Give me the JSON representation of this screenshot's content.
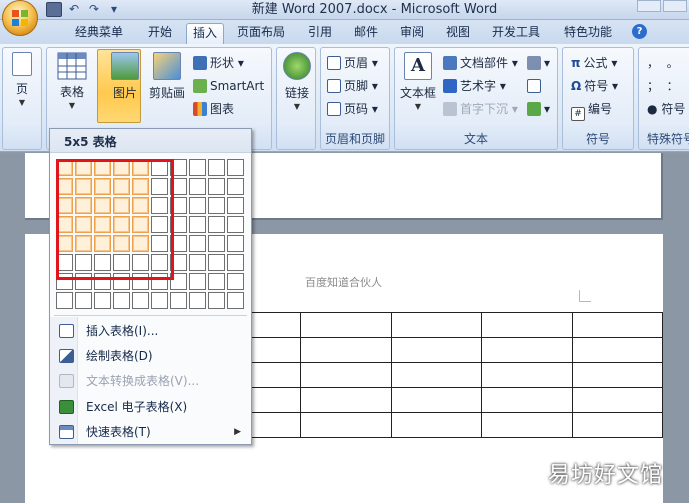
{
  "window": {
    "title": "新建 Word 2007.docx - Microsoft Word"
  },
  "tabs": [
    "经典菜单",
    "开始",
    "插入",
    "页面布局",
    "引用",
    "邮件",
    "审阅",
    "视图",
    "开发工具",
    "特色功能"
  ],
  "active_tab": "插入",
  "ribbon": {
    "page_label": "页",
    "table_label": "表格",
    "picture_label": "图片",
    "clipart_label": "剪贴画",
    "shapes_label": "形状",
    "smartart_label": "SmartArt",
    "chart_label": "图表",
    "link_label": "链接",
    "header_label": "页眉",
    "footer_label": "页脚",
    "pagenum_label": "页码",
    "group_header_footer": "页眉和页脚",
    "textbox_label": "文本框",
    "docparts_label": "文档部件",
    "wordart_label": "艺术字",
    "dropcap_label": "首字下沉",
    "group_text": "文本",
    "formula_label": "公式",
    "symbol_label": "符号",
    "number_label": "编号",
    "group_symbol": "符号",
    "special_symbol_label": "符号",
    "group_special": "特殊符号"
  },
  "menu": {
    "header": "5x5 表格",
    "grid_cols": 10,
    "grid_rows": 8,
    "selected_cols": 5,
    "selected_rows": 5,
    "items": [
      {
        "label": "插入表格(I)...",
        "icon": "insert-table-icon",
        "disabled": false,
        "submenu": false
      },
      {
        "label": "绘制表格(D)",
        "icon": "draw-table-icon",
        "disabled": false,
        "submenu": false
      },
      {
        "label": "文本转换成表格(V)...",
        "icon": "text-to-table-icon",
        "disabled": true,
        "submenu": false
      },
      {
        "label": "Excel 电子表格(X)",
        "icon": "excel-sheet-icon",
        "disabled": false,
        "submenu": false
      },
      {
        "label": "快速表格(T)",
        "icon": "quick-table-icon",
        "disabled": false,
        "submenu": true
      }
    ]
  },
  "document": {
    "header_text": "百度知道合伙人",
    "table_rows": 5,
    "table_cols": 5
  },
  "watermark": "易坊好文馆",
  "colors": {
    "selection_orange": "#f0a048",
    "highlight_red": "#e0151b",
    "active_button": "#ffc94d"
  }
}
